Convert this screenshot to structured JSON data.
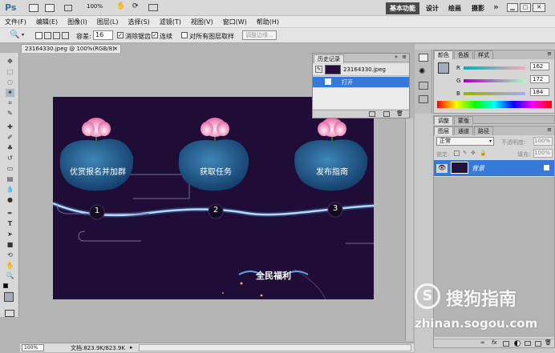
{
  "app": {
    "logo": "Ps",
    "zoom": "100%",
    "workspaces": [
      "基本功能",
      "设计",
      "绘画",
      "摄影"
    ],
    "more": "»"
  },
  "menu": [
    "文件(F)",
    "编辑(E)",
    "图像(I)",
    "图层(L)",
    "选择(S)",
    "滤镜(T)",
    "视图(V)",
    "窗口(W)",
    "帮助(H)"
  ],
  "options": {
    "tolerance_label": "容差:",
    "tolerance_value": "16",
    "antialias": "消除锯齿",
    "contiguous": "连续",
    "sample_all": "对所有图层取样",
    "refine": "调整边缘..."
  },
  "document": {
    "tab": "23164330.jpeg @ 100%(RGB/8)",
    "zoom": "100%",
    "status": "文档:823.9K/823.9K"
  },
  "image_content": {
    "steps": [
      {
        "label": "优赏报名并加群",
        "num": "1"
      },
      {
        "label": "获取任务",
        "num": "2"
      },
      {
        "label": "发布指南",
        "num": "3"
      }
    ],
    "banner": "全民福利"
  },
  "history": {
    "title": "历史记录",
    "snapshot": "23164330.jpeg",
    "state": "打开"
  },
  "color_panel": {
    "tabs": [
      "颜色",
      "色板",
      "样式"
    ],
    "r_label": "R",
    "g_label": "G",
    "b_label": "B",
    "r": "162",
    "g": "172",
    "b": "184"
  },
  "adjust_panel": {
    "tabs": [
      "调整",
      "蒙版"
    ]
  },
  "layers_panel": {
    "tabs": [
      "图层",
      "通道",
      "路径"
    ],
    "blend_mode": "正常",
    "opacity_label": "不透明度:",
    "opacity": "100%",
    "lock_label": "锁定:",
    "fill_label": "填充:",
    "fill": "100%",
    "layer_name": "背景"
  },
  "watermark": {
    "brand": "搜狗指南",
    "url": "zhinan.sogou.com"
  }
}
